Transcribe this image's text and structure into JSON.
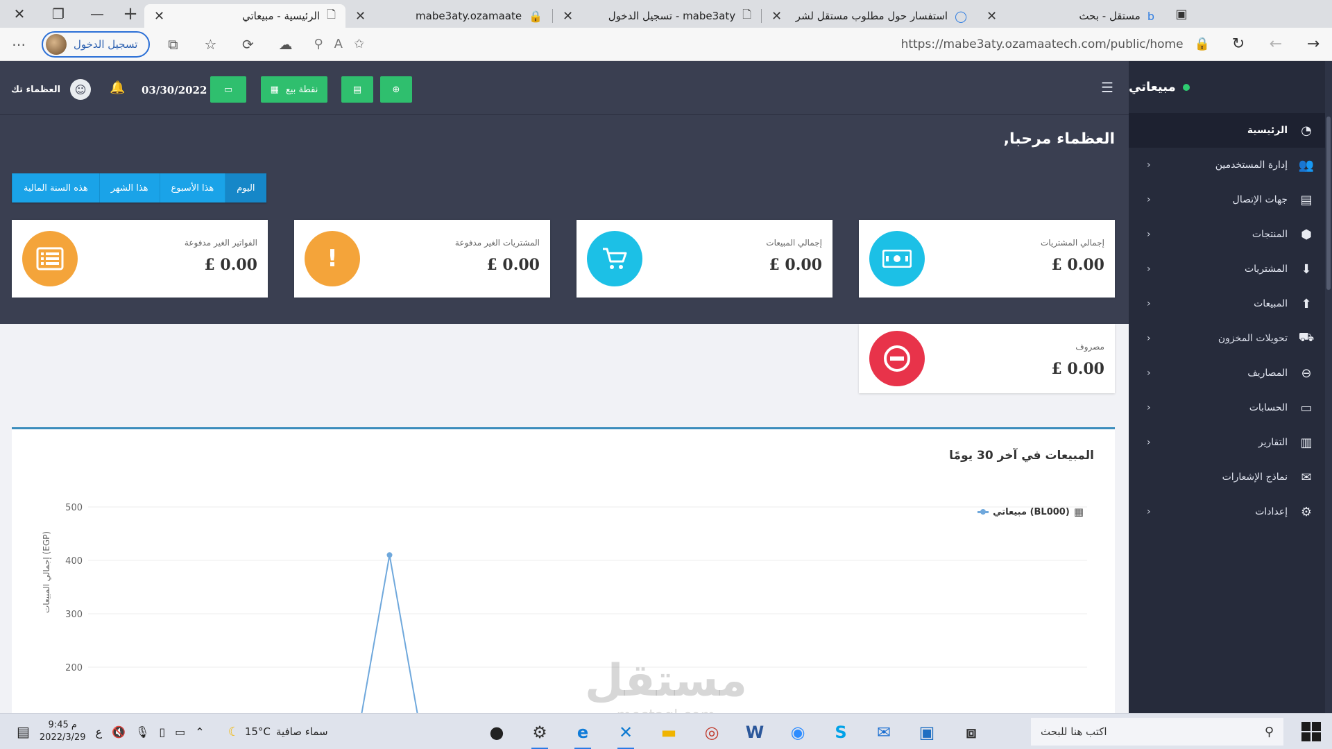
{
  "browser": {
    "tabs": [
      {
        "title": "مستقل - بحث",
        "icon": "bing-icon"
      },
      {
        "title": "استفسار حول مطلوب مستقل لشر",
        "icon": "circle-icon"
      },
      {
        "title": "mabe3aty - تسجيل الدخول",
        "icon": "page-icon"
      },
      {
        "title": "mabe3aty.ozamaate",
        "icon": "lock-page-icon"
      },
      {
        "title": "الرئيسية - مبيعاتي",
        "icon": "page-icon"
      }
    ],
    "url": "https://mabe3aty.ozamaatech.com/public/home",
    "profile_label": "تسجيل الدخول"
  },
  "sidebar": {
    "brand": "مبيعاتي",
    "items": [
      {
        "label": "الرئيسية",
        "icon": "dashboard-icon",
        "active": true,
        "submenu": false
      },
      {
        "label": "إدارة المستخدمين",
        "icon": "users-icon",
        "active": false,
        "submenu": true
      },
      {
        "label": "جهات الإتصال",
        "icon": "address-book-icon",
        "active": false,
        "submenu": true
      },
      {
        "label": "المنتجات",
        "icon": "cubes-icon",
        "active": false,
        "submenu": true
      },
      {
        "label": "المشتريات",
        "icon": "arrow-circle-down-icon",
        "active": false,
        "submenu": true
      },
      {
        "label": "المبيعات",
        "icon": "arrow-circle-up-icon",
        "active": false,
        "submenu": true
      },
      {
        "label": "تحويلات المخزون",
        "icon": "truck-icon",
        "active": false,
        "submenu": true
      },
      {
        "label": "المصاريف",
        "icon": "minus-circle-icon",
        "active": false,
        "submenu": true
      },
      {
        "label": "الحسابات",
        "icon": "money-icon",
        "active": false,
        "submenu": true
      },
      {
        "label": "التقارير",
        "icon": "bar-chart-icon",
        "active": false,
        "submenu": true
      },
      {
        "label": "نماذج الإشعارات",
        "icon": "envelope-icon",
        "active": false,
        "submenu": false
      },
      {
        "label": "إعدادات",
        "icon": "cog-icon",
        "active": false,
        "submenu": true
      }
    ]
  },
  "topbar": {
    "user_name": "العظماء تك",
    "date": "03/30/2022",
    "pos_label": "نقطة بيع"
  },
  "welcome": "العظماء مرحبا,",
  "periods": [
    "اليوم",
    "هذا الأسبوع",
    "هذا الشهر",
    "هذه السنة المالية"
  ],
  "cards": [
    {
      "label": "إجمالي المشتريات",
      "value": "£ 0.00",
      "color": "#1cc0e6",
      "icon": "money-icon"
    },
    {
      "label": "إجمالي المبيعات",
      "value": "£ 0.00",
      "color": "#1cc0e6",
      "icon": "cart-icon"
    },
    {
      "label": "المشتريات الغير مدفوعة",
      "value": "£ 0.00",
      "color": "#f4a43a",
      "icon": "exclamation-icon"
    },
    {
      "label": "الفواتير الغير مدفوعة",
      "value": "£ 0.00",
      "color": "#f4a43a",
      "icon": "invoice-icon"
    },
    {
      "label": "مصروف",
      "value": "£ 0.00",
      "color": "#e8334a",
      "icon": "minus-circle-icon"
    }
  ],
  "chart_title": "المبيعات في آخر 30 يومًا",
  "chart_data": {
    "type": "line",
    "title": "المبيعات في آخر 30 يومًا",
    "ylabel": "(EGP) إجمالي المبيعات",
    "yticks": [
      200,
      300,
      400,
      500
    ],
    "ylim": [
      0,
      500
    ],
    "legend": "right",
    "series": [
      {
        "name": "(BL000) مبيعاتي",
        "color": "#6fa8dc",
        "x": [
          0,
          1,
          2,
          3,
          4,
          5,
          6,
          7,
          8
        ],
        "values": [
          0,
          0,
          0,
          0,
          0,
          0,
          0,
          410,
          0
        ]
      }
    ]
  },
  "taskbar": {
    "search_placeholder": "اكتب هنا للبحث",
    "weather": "سماء صافية",
    "temperature": "15°C",
    "time": "9:45 م",
    "date": "2022/3/29",
    "lang": "ع"
  },
  "watermark": "مستقل",
  "watermark_sub": "mostaql.com"
}
